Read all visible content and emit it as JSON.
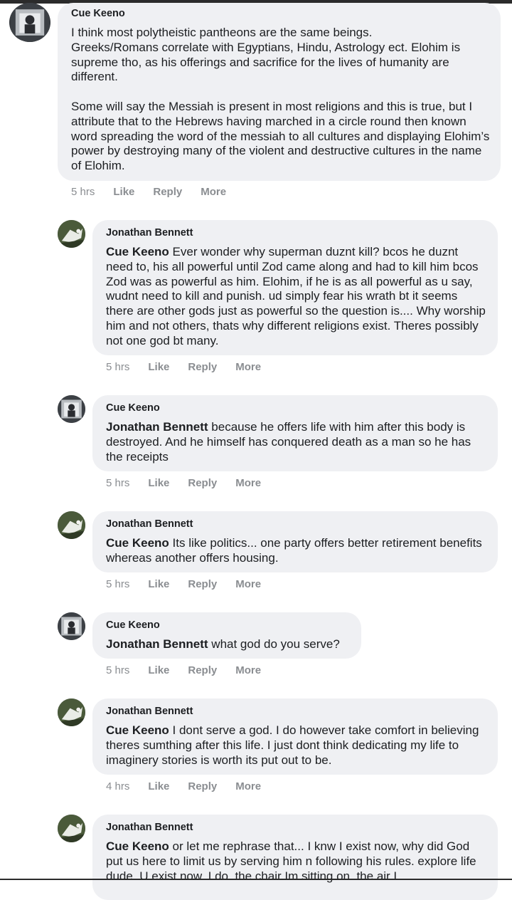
{
  "comments": [
    {
      "author": "Cue Keeno",
      "mention": "",
      "body": "I think most polytheistic pantheons are the same beings.\nGreeks/Romans correlate with Egyptians, Hindu, Astrology ect. Elohim is supreme tho, as his offerings and sacrifice for the lives of humanity are different.\n\nSome will say the Messiah is present in most religions and this is true, but I attribute that to the Hebrews having marched in a circle round then known word spreading the word of the messiah to all cultures and displaying Elohim’s power by destroying many of the violent and destructive cultures in the name of Elohim.",
      "time": "5 hrs"
    },
    {
      "author": "Jonathan Bennett",
      "mention": "Cue Keeno",
      "body": " Ever wonder why superman duznt kill? bcos he duznt need to, his all powerful until Zod came along and had to kill him bcos Zod was as powerful as him. Elohim, if he is as all powerful as u say, wudnt need to kill and punish. ud simply fear his wrath bt it seems there are other gods just as powerful so the question is.... Why worship him and not others, thats why different religions exist. Theres possibly not one god bt many.",
      "time": "5 hrs"
    },
    {
      "author": "Cue Keeno",
      "mention": "Jonathan Bennett",
      "body": " because he offers life with him after this body is destroyed. And he himself has conquered death as a man so he has the receipts",
      "time": "5 hrs"
    },
    {
      "author": "Jonathan Bennett",
      "mention": "Cue Keeno",
      "body": " Its like politics... one party offers better retirement benefits whereas another offers housing.",
      "time": "5 hrs"
    },
    {
      "author": "Cue Keeno",
      "mention": "Jonathan Bennett",
      "body": " what god do you serve?",
      "time": "5 hrs"
    },
    {
      "author": "Jonathan Bennett",
      "mention": "Cue Keeno",
      "body": " I dont serve a god. I do however take comfort in believing theres sumthing after this life. I just dont think dedicating my life to imaginery stories is worth its put out to be.",
      "time": "4 hrs"
    },
    {
      "author": "Jonathan Bennett",
      "mention": "Cue Keeno",
      "body": " or let me rephrase that... I knw I exist now, why did God put us here to limit us by serving him n following his rules. explore life dude. U exist now. I do. the chair Im sitting on. the air I"
    }
  ],
  "actions": {
    "like": "Like",
    "reply": "Reply",
    "more": "More"
  },
  "colors": {
    "bubble": "#eff0f3",
    "meta": "#8a8d91"
  },
  "icons": {
    "cue_avatar": "profile-photo-person",
    "jonathan_avatar": "profile-photo-eagle"
  }
}
